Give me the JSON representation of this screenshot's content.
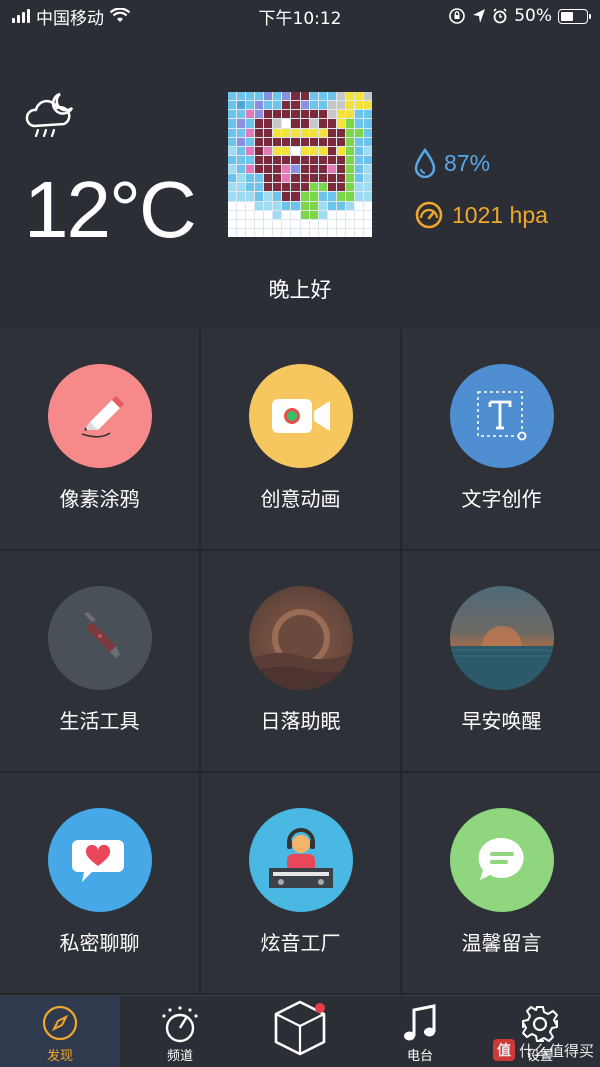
{
  "status_bar": {
    "carrier": "中国移动",
    "time": "下午10:12",
    "battery": "50%"
  },
  "weather": {
    "icon": "night-cloud-rain-icon",
    "temperature": "12°C",
    "humidity": "87%",
    "pressure": "1021 hpa",
    "greeting": "晚上好"
  },
  "colors": {
    "background": "#2b2f35",
    "tile": "#2e3238",
    "humidity": "#5aa7e8",
    "pressure": "#f0a72b",
    "active_tab": "#f0a72b"
  },
  "tiles": [
    {
      "label": "像素涂鸦",
      "icon": "pencil-icon",
      "color": "#f68a8a"
    },
    {
      "label": "创意动画",
      "icon": "video-camera-icon",
      "color": "#f7c75f"
    },
    {
      "label": "文字创作",
      "icon": "text-t-icon",
      "color": "#4f8fd1"
    },
    {
      "label": "生活工具",
      "icon": "swiss-knife-icon",
      "color": "#4a5057"
    },
    {
      "label": "日落助眠",
      "icon": "sunset-icon",
      "color": "#6b4a3e"
    },
    {
      "label": "早安唤醒",
      "icon": "sunrise-icon",
      "color": "#3f5a66"
    },
    {
      "label": "私密聊聊",
      "icon": "heart-chat-icon",
      "color": "#46a8e6"
    },
    {
      "label": "炫音工厂",
      "icon": "dj-icon",
      "color": "#49b8e3"
    },
    {
      "label": "温馨留言",
      "icon": "message-icon",
      "color": "#8fd67f"
    }
  ],
  "tabs": [
    {
      "label": "发现",
      "icon": "compass-icon"
    },
    {
      "label": "频道",
      "icon": "dial-icon"
    },
    {
      "label": "",
      "icon": "cube-icon"
    },
    {
      "label": "电台",
      "icon": "music-note-icon"
    },
    {
      "label": "设置",
      "icon": "gear-icon"
    }
  ],
  "watermark": {
    "badge": "值",
    "text": "什么值得买"
  }
}
